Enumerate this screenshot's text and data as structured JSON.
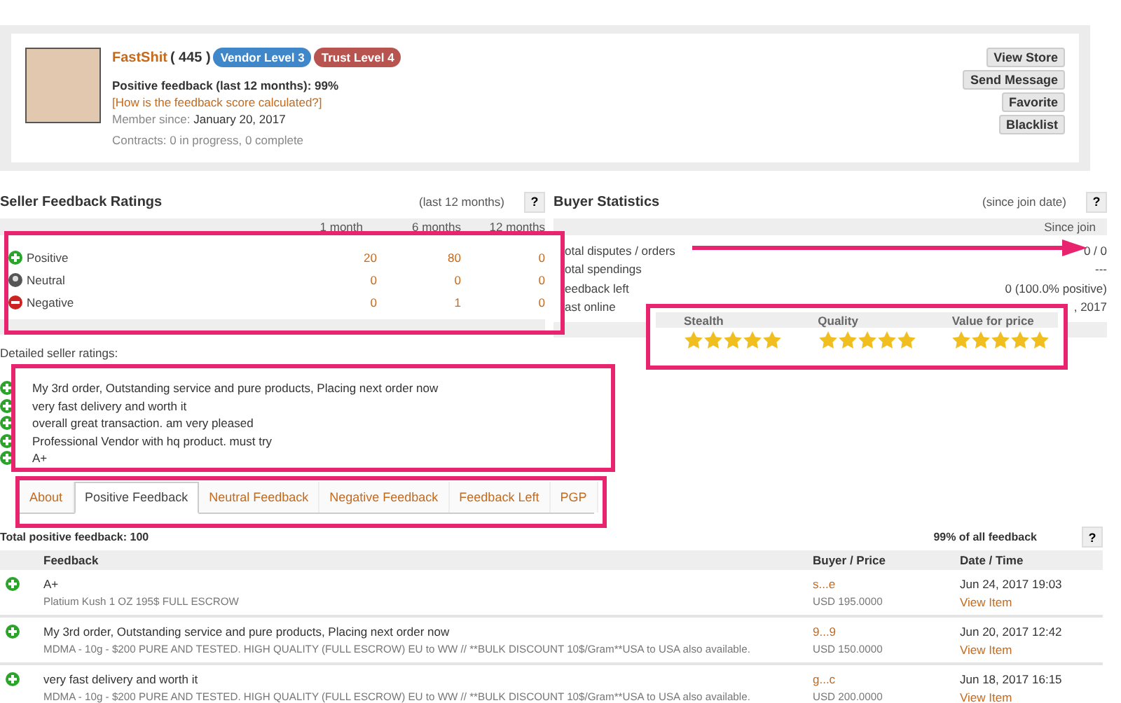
{
  "vendor": {
    "name": "FastShit",
    "score": "( 445 )",
    "badges": [
      {
        "label": "Vendor Level 3",
        "color": "#3f87c9"
      },
      {
        "label": "Trust Level 4",
        "color": "#b85450"
      }
    ],
    "positive": "Positive feedback (last 12 months): 99%",
    "help_link": "[How is the feedback score calculated?]",
    "member_label": "Member since:",
    "member_value": "January 20, 2017",
    "contracts": "Contracts: 0 in progress, 0 complete",
    "actions": [
      "View Store",
      "Send Message",
      "Favorite",
      "Blacklist"
    ]
  },
  "seller_ratings": {
    "title": "Seller Feedback Ratings",
    "period": "(last 12 months)",
    "help": "?",
    "columns": [
      "1 month",
      "6 months",
      "12 months"
    ],
    "rows": [
      {
        "kind": "positive",
        "label": "Positive",
        "values": [
          "20",
          "80",
          "0"
        ]
      },
      {
        "kind": "neutral",
        "label": "Neutral",
        "values": [
          "0",
          "0",
          "0"
        ]
      },
      {
        "kind": "negative",
        "label": "Negative",
        "values": [
          "0",
          "1",
          "0"
        ]
      }
    ]
  },
  "buyer_stats": {
    "title": "Buyer Statistics",
    "period": "(since join date)",
    "help": "?",
    "column": "Since join",
    "rows": [
      {
        "label": "otal disputes / orders",
        "value": "0 / 0"
      },
      {
        "label": "otal spendings",
        "value": "---"
      },
      {
        "label": "eedback left",
        "value": "0 (100.0% positive)"
      },
      {
        "label": "ast online",
        "value": ", 2017"
      }
    ]
  },
  "detailed_ratings": {
    "title": "Detailed seller ratings:",
    "criteria": [
      {
        "label": "Stealth",
        "stars": 5
      },
      {
        "label": "Quality",
        "stars": 5
      },
      {
        "label": "Value for price",
        "stars": 5
      }
    ],
    "comments": [
      {
        "kind": "positive",
        "text": "My 3rd order, Outstanding service and pure products, Placing next order now"
      },
      {
        "kind": "positive",
        "text": "very fast delivery and worth it"
      },
      {
        "kind": "positive",
        "text": "overall great transaction. am very pleased"
      },
      {
        "kind": "positive",
        "text": "Professional Vendor with hq product. must try"
      },
      {
        "kind": "positive",
        "text": "A+"
      }
    ]
  },
  "tabs": [
    {
      "label": "About",
      "selected": false
    },
    {
      "label": "Positive Feedback",
      "selected": true
    },
    {
      "label": "Neutral Feedback",
      "selected": false
    },
    {
      "label": "Negative Feedback",
      "selected": false
    },
    {
      "label": "Feedback Left",
      "selected": false
    },
    {
      "label": "PGP",
      "selected": false
    }
  ],
  "feedback": {
    "total": "Total positive feedback: 100",
    "share": "99% of all feedback",
    "help": "?",
    "columns": [
      "Feedback",
      "Buyer / Price",
      "Date / Time"
    ],
    "rows": [
      {
        "kind": "positive",
        "comment": "A+",
        "item": "Platium Kush 1 OZ 195$ FULL ESCROW",
        "buyer": "s...e",
        "price": "USD 195.0000",
        "date": "Jun 24, 2017 19:03",
        "link": "View Item"
      },
      {
        "kind": "positive",
        "comment": "My 3rd order, Outstanding service and pure products, Placing next order now",
        "item": "MDMA - 10g - $200 PURE AND TESTED. HIGH QUALITY (FULL ESCROW) EU to WW // **BULK DISCOUNT 10$/Gram**USA to USA also available.",
        "buyer": "9...9",
        "price": "USD 150.0000",
        "date": "Jun 20, 2017 12:42",
        "link": "View Item"
      },
      {
        "kind": "positive",
        "comment": "very fast delivery and worth it",
        "item": "MDMA - 10g - $200 PURE AND TESTED. HIGH QUALITY (FULL ESCROW) EU to WW // **BULK DISCOUNT 10$/Gram**USA to USA also available.",
        "buyer": "g...c",
        "price": "USD 200.0000",
        "date": "Jun 18, 2017 16:15",
        "link": "View Item"
      }
    ]
  }
}
